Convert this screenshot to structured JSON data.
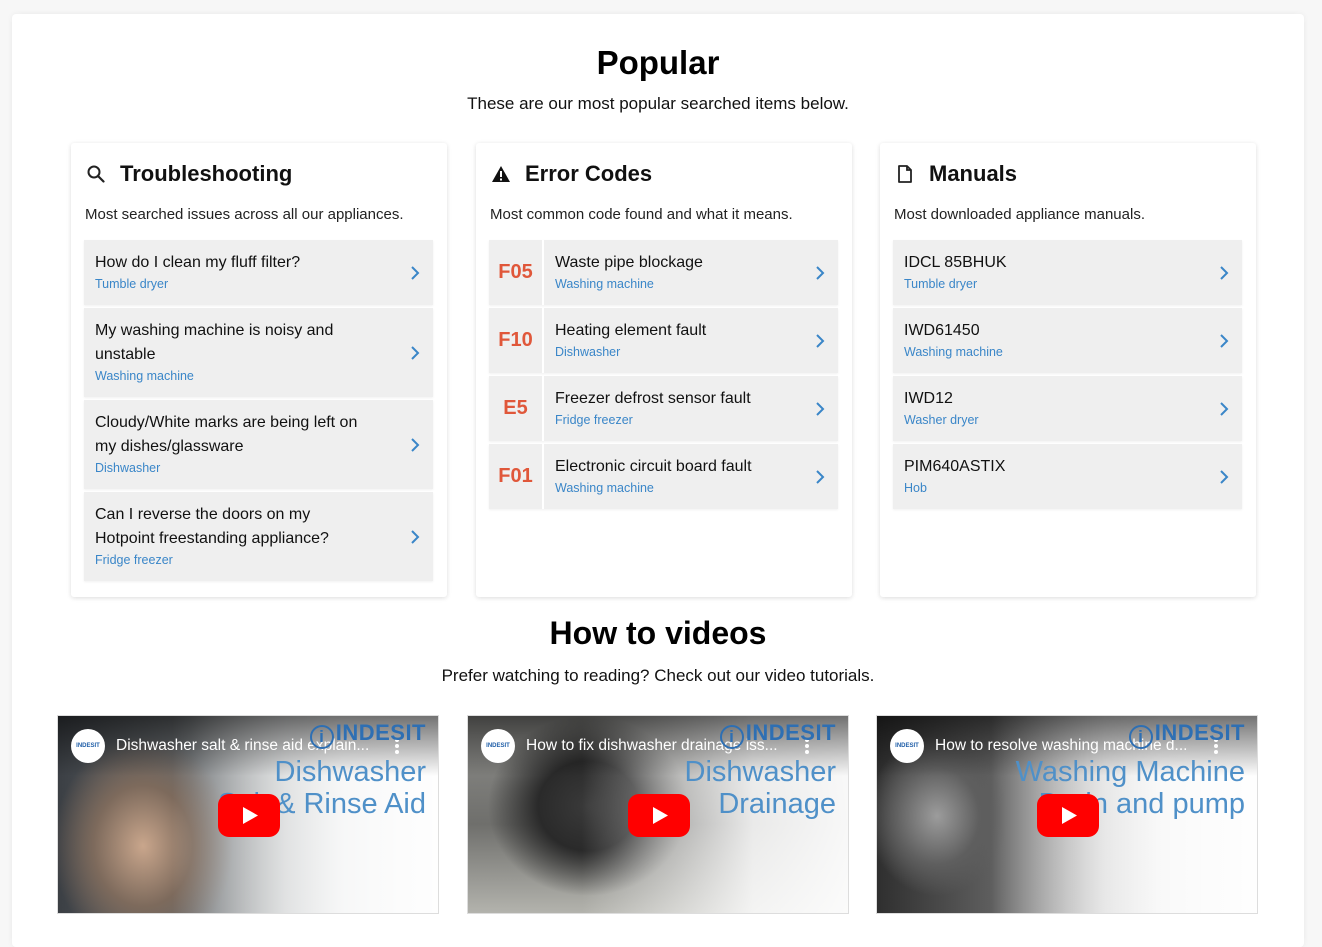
{
  "popular": {
    "title": "Popular",
    "subtitle": "These are our most popular searched items below."
  },
  "troubleshooting": {
    "icon": "search-icon",
    "title": "Troubleshooting",
    "description": "Most searched issues across all our appliances.",
    "items": [
      {
        "question": "How do I clean my fluff filter?",
        "category": "Tumble dryer"
      },
      {
        "question": "My washing machine is noisy and unstable",
        "category": "Washing machine"
      },
      {
        "question": "Cloudy/White marks are being left on my dishes/glassware",
        "category": "Dishwasher"
      },
      {
        "question": "Can I reverse the doors on my Hotpoint freestanding appliance?",
        "category": "Fridge freezer"
      }
    ]
  },
  "error_codes": {
    "icon": "warning-icon",
    "title": "Error Codes",
    "description": "Most common code found and what it means.",
    "items": [
      {
        "code": "F05",
        "name": "Waste pipe blockage",
        "category": "Washing machine"
      },
      {
        "code": "F10",
        "name": "Heating element fault",
        "category": "Dishwasher"
      },
      {
        "code": "E5",
        "name": "Freezer defrost sensor fault",
        "category": "Fridge freezer"
      },
      {
        "code": "F01",
        "name": "Electronic circuit board fault",
        "category": "Washing machine"
      }
    ]
  },
  "manuals": {
    "icon": "document-icon",
    "title": "Manuals",
    "description": "Most downloaded appliance manuals.",
    "items": [
      {
        "model": "IDCL 85BHUK",
        "category": "Tumble dryer"
      },
      {
        "model": "IWD61450",
        "category": "Washing machine"
      },
      {
        "model": "IWD12",
        "category": "Washer dryer"
      },
      {
        "model": "PIM640ASTIX",
        "category": "Hob"
      }
    ]
  },
  "videos": {
    "title": "How to videos",
    "subtitle": "Prefer watching to reading? Check out our video tutorials.",
    "brand": "INDESIT",
    "channel_badge": "INDESIT",
    "items": [
      {
        "title": "Dishwasher salt & rinse aid explain...",
        "overlay_line1": "Dishwasher",
        "overlay_line2": "Salt & Rinse Aid"
      },
      {
        "title": "How to fix dishwasher drainage iss...",
        "overlay_line1": "Dishwasher",
        "overlay_line2": "Drainage"
      },
      {
        "title": "How to resolve washing machine d...",
        "overlay_line1": "Washing Machine",
        "overlay_line2": "Drain and pump"
      }
    ]
  },
  "colors": {
    "link_blue": "#3a86c8",
    "error_code_red": "#e0573a",
    "play_red": "#ff0000",
    "brand_blue": "#2e6fb3"
  }
}
